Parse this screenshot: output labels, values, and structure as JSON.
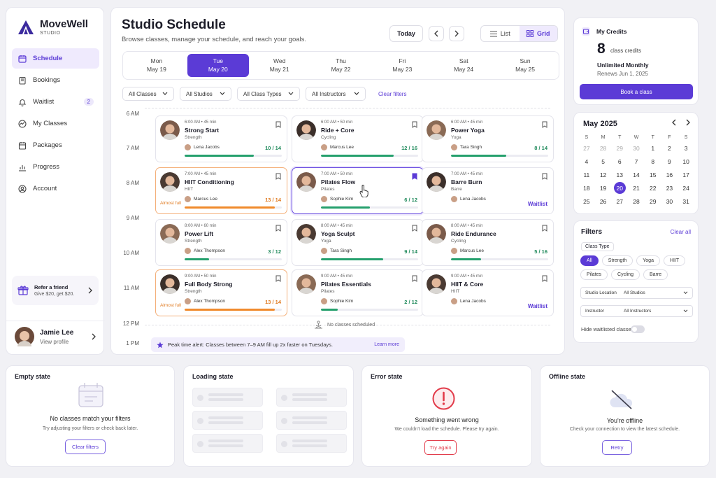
{
  "app": {
    "name": "MoveWell",
    "tagline": "STUDIO"
  },
  "sidebar": {
    "items": [
      {
        "label": "Schedule",
        "icon": "calendar-icon",
        "active": true
      },
      {
        "label": "Bookings",
        "icon": "book-icon"
      },
      {
        "label": "Waitlist",
        "icon": "bell-icon",
        "badge": "2"
      },
      {
        "label": "My Classes",
        "icon": "activity-icon"
      },
      {
        "label": "Packages",
        "icon": "package-icon"
      },
      {
        "label": "Progress",
        "icon": "chart-icon"
      },
      {
        "label": "Account",
        "icon": "user-icon"
      }
    ],
    "refer": {
      "title": "Refer a friend",
      "subtitle": "Give $20, get $20."
    },
    "profile": {
      "name": "Jamie Lee",
      "link": "View profile"
    }
  },
  "header": {
    "title": "Studio Schedule",
    "subtitle": "Browse classes, manage your schedule, and reach your goals.",
    "today": "Today",
    "view_list": "List",
    "view_grid": "Grid"
  },
  "days": [
    {
      "dow": "Mon",
      "date": "May 19"
    },
    {
      "dow": "Tue",
      "date": "May 20",
      "active": true
    },
    {
      "dow": "Wed",
      "date": "May 21"
    },
    {
      "dow": "Thu",
      "date": "May 22"
    },
    {
      "dow": "Fri",
      "date": "May 23"
    },
    {
      "dow": "Sat",
      "date": "May 24"
    },
    {
      "dow": "Sun",
      "date": "May 25"
    }
  ],
  "filter_bar": {
    "classes": "All Classes",
    "studios": "All Studios",
    "types": "All Class Types",
    "instructors": "All Instructors",
    "clear": "Clear filters"
  },
  "times": [
    "6 AM",
    "7 AM",
    "8 AM",
    "9 AM",
    "10 AM",
    "11 AM",
    "12 PM",
    "1 PM"
  ],
  "classes": [
    {
      "time": "6:00 AM • 45 min",
      "name": "Strong Start",
      "type": "Strength",
      "instructor": "Lena Jacobs",
      "count": "10 / 14",
      "fill": 0.71
    },
    {
      "time": "6:00 AM • 50 min",
      "name": "Ride + Core",
      "type": "Cycling",
      "instructor": "Marcus Lee",
      "count": "12 / 16",
      "fill": 0.75
    },
    {
      "time": "6:00 AM • 45 min",
      "name": "Power Yoga",
      "type": "Yoga",
      "instructor": "Tara Singh",
      "count": "8 / 14",
      "fill": 0.57
    },
    {
      "time": "7:00 AM • 45 min",
      "name": "HIIT Conditioning",
      "type": "HIIT",
      "instructor": "Marcus Lee",
      "count": "13 / 14",
      "fill": 0.93,
      "almost": "Almost full"
    },
    {
      "time": "7:00 AM • 50 min",
      "name": "Pilates Flow",
      "type": "Pilates",
      "instructor": "Sophie Kim",
      "count": "6 / 12",
      "fill": 0.5,
      "selected": true
    },
    {
      "time": "7:00 AM • 45 min",
      "name": "Barre Burn",
      "type": "Barre",
      "instructor": "Lena Jacobs",
      "waitlist": "Waitlist"
    },
    {
      "time": "8:00 AM • 60 min",
      "name": "Power Lift",
      "type": "Strength",
      "instructor": "Alex Thompson",
      "count": "3 / 12",
      "fill": 0.25
    },
    {
      "time": "8:00 AM • 45 min",
      "name": "Yoga Sculpt",
      "type": "Yoga",
      "instructor": "Tara Singh",
      "count": "9 / 14",
      "fill": 0.64
    },
    {
      "time": "8:00 AM • 45 min",
      "name": "Ride Endurance",
      "type": "Cycling",
      "instructor": "Marcus Lee",
      "count": "5 / 16",
      "fill": 0.31
    },
    {
      "time": "9:00 AM • 50 min",
      "name": "Full Body Strong",
      "type": "Strength",
      "instructor": "Alex Thompson",
      "count": "13 / 14",
      "fill": 0.93,
      "almost": "Almost full"
    },
    {
      "time": "9:00 AM • 45 min",
      "name": "Pilates Essentials",
      "type": "Pilates",
      "instructor": "Sophie Kim",
      "count": "2 / 12",
      "fill": 0.17
    },
    {
      "time": "9:00 AM • 45 min",
      "name": "HIIT & Core",
      "type": "HIIT",
      "instructor": "Lena Jacobs",
      "waitlist": "Waitlist"
    }
  ],
  "empty_slot": "No classes scheduled",
  "alert": {
    "text": "Peak time alert: Classes between 7–9 AM fill up 2x faster on Tuesdays.",
    "link": "Learn more"
  },
  "credits": {
    "title": "My Credits",
    "count": "8",
    "unit": "class credits",
    "plan": "Unlimited Monthly",
    "renews": "Renews Jun 1, 2025",
    "book": "Book a class"
  },
  "calendar": {
    "month": "May 2025",
    "weekdays": [
      "S",
      "M",
      "T",
      "W",
      "T",
      "F",
      "S"
    ],
    "days": [
      "27",
      "28",
      "29",
      "30",
      "1",
      "2",
      "3",
      "4",
      "5",
      "6",
      "7",
      "8",
      "9",
      "10",
      "11",
      "12",
      "13",
      "14",
      "15",
      "16",
      "17",
      "18",
      "19",
      "20",
      "21",
      "22",
      "23",
      "24",
      "25",
      "26",
      "27",
      "28",
      "29",
      "30",
      "31"
    ],
    "selected": "20"
  },
  "filters_panel": {
    "title": "Filters",
    "clear": "Clear all",
    "class_type": "Class Type",
    "chips": [
      "All",
      "Strength",
      "Yoga",
      "HIIT",
      "Pilates",
      "Cycling",
      "Barre"
    ],
    "location_label": "Studio Location",
    "location_value": "All Studios",
    "instructor_label": "Instructor",
    "instructor_value": "All Instructors",
    "hide_waitlisted": "Hide waitlisted classes"
  },
  "states": {
    "empty": {
      "title": "Empty state",
      "heading": "No classes match your filters",
      "text": "Try adjusting your filters or check back later.",
      "button": "Clear filters"
    },
    "loading": {
      "title": "Loading state"
    },
    "error": {
      "title": "Error state",
      "heading": "Something went wrong",
      "text": "We couldn't load the schedule. Please try again.",
      "button": "Try again"
    },
    "offline": {
      "title": "Offline state",
      "heading": "You're offline",
      "text": "Check your connection to view the latest schedule.",
      "button": "Retry"
    }
  },
  "colors": {
    "accent": "#5b3bd6",
    "success": "#25a06d",
    "warning": "#f08a2c",
    "error": "#e23b4a"
  }
}
